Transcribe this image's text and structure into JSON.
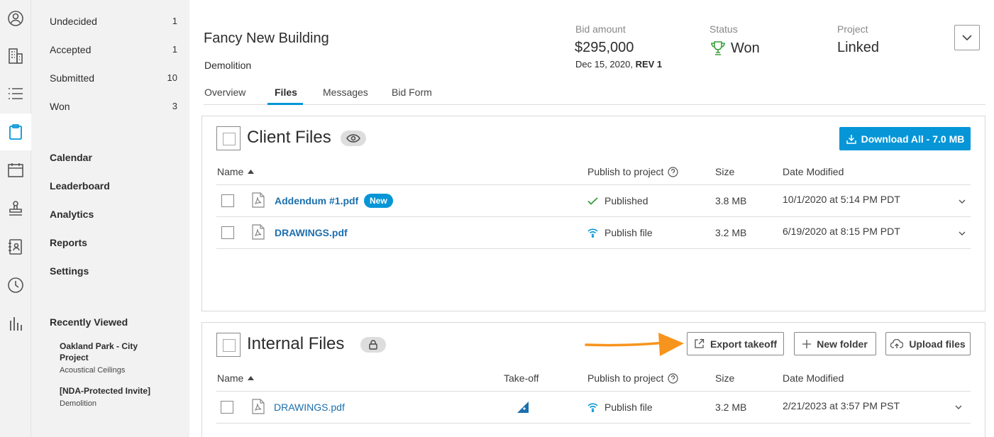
{
  "colors": {
    "accent": "#0696d7",
    "link": "#1b6fae",
    "success": "#3a9e3a",
    "arrow": "#f7941d"
  },
  "rail": {
    "icons": [
      "user-circle-icon",
      "building-icon",
      "list-icon",
      "clipboard-icon",
      "calendar-icon",
      "stamp-icon",
      "address-book-icon",
      "clock-icon",
      "bar-chart-icon"
    ]
  },
  "sidebar": {
    "statuses": [
      {
        "label": "Undecided",
        "count": "1"
      },
      {
        "label": "Accepted",
        "count": "1"
      },
      {
        "label": "Submitted",
        "count": "10"
      },
      {
        "label": "Won",
        "count": "3"
      }
    ],
    "links": [
      "Calendar",
      "Leaderboard",
      "Analytics",
      "Reports",
      "Settings"
    ],
    "recent_heading": "Recently Viewed",
    "recent": [
      {
        "title": "Oakland Park - City Project",
        "sub": "Acoustical Ceilings"
      },
      {
        "title": "[NDA-Protected Invite]",
        "sub": "Demolition"
      }
    ]
  },
  "header": {
    "title": "Fancy New Building",
    "subtitle": "Demolition",
    "bid_label": "Bid amount",
    "bid_value": "$295,000",
    "bid_date": "Dec 15, 2020,",
    "bid_rev": "REV 1",
    "status_label": "Status",
    "status_value": "Won",
    "project_label": "Project",
    "project_value": "Linked"
  },
  "tabs": [
    "Overview",
    "Files",
    "Messages",
    "Bid Form"
  ],
  "client_files": {
    "title": "Client Files",
    "download_label": "Download All - 7.0 MB",
    "columns": {
      "name": "Name",
      "publish": "Publish to project",
      "size": "Size",
      "date": "Date Modified"
    },
    "rows": [
      {
        "name": "Addendum #1.pdf",
        "badge": "New",
        "publish": "Published",
        "size": "3.8 MB",
        "date": "10/1/2020 at 5:14 PM PDT"
      },
      {
        "name": "DRAWINGS.pdf",
        "publish": "Publish file",
        "size": "3.2 MB",
        "date": "6/19/2020 at 8:15 PM PDT"
      }
    ]
  },
  "internal_files": {
    "title": "Internal Files",
    "export_label": "Export takeoff",
    "new_folder_label": "New folder",
    "upload_label": "Upload files",
    "columns": {
      "name": "Name",
      "takeoff": "Take-off",
      "publish": "Publish to project",
      "size": "Size",
      "date": "Date Modified"
    },
    "rows": [
      {
        "name": "DRAWINGS.pdf",
        "publish": "Publish file",
        "size": "3.2 MB",
        "date": "2/21/2023 at 3:57 PM PST"
      }
    ]
  }
}
